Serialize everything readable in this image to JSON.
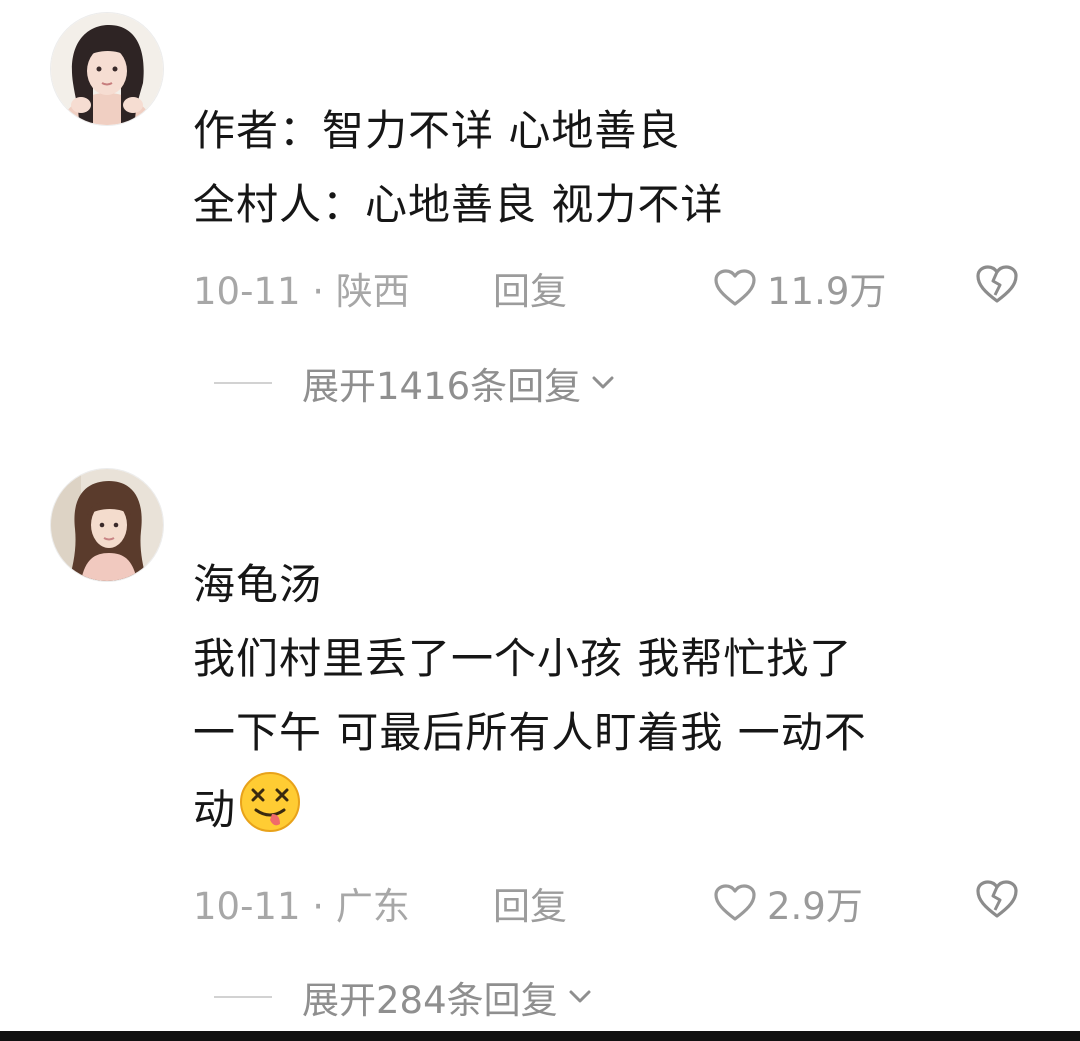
{
  "comments": [
    {
      "username": "",
      "avatar": "avatar-girl-pink",
      "lines": [
        "作者：智力不详 心地善良",
        "全村人：心地善良 视力不详"
      ],
      "date": "10-11",
      "separator": "·",
      "location": "陕西",
      "reply_label": "回复",
      "like_count": "11.9万",
      "like_icon": "heart-outline-icon",
      "dislike_icon": "broken-heart-icon",
      "expand_label": "展开1416条回复"
    },
    {
      "username": "",
      "avatar": "avatar-girl-beige",
      "lines": [
        "海龟汤",
        "我们村里丢了一个小孩 我帮忙找了",
        "一下午 可最后所有人盯着我 一动不",
        "动"
      ],
      "emoji": "dizzy-tongue-face-emoji",
      "date": "10-11",
      "separator": "·",
      "location": "广东",
      "reply_label": "回复",
      "like_count": "2.9万",
      "like_icon": "heart-outline-icon",
      "dislike_icon": "broken-heart-icon",
      "expand_label": "展开284条回复"
    }
  ],
  "colors": {
    "text_primary": "#161616",
    "text_secondary": "#a7a7a7",
    "divider": "#d2d2d2"
  }
}
